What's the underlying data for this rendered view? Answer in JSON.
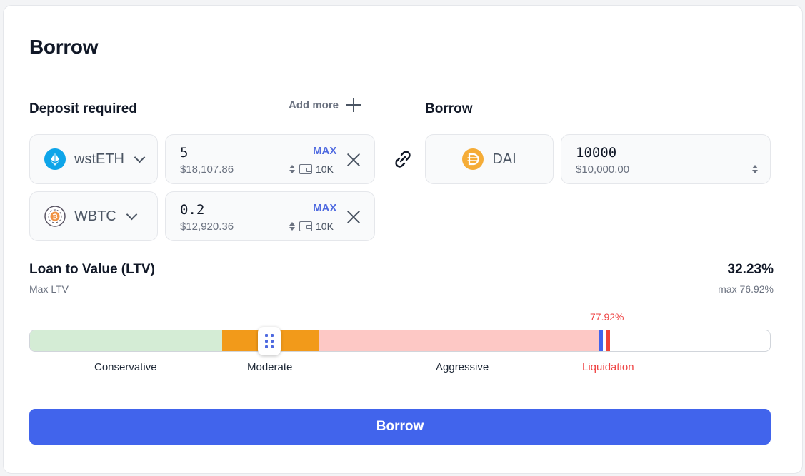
{
  "title": "Borrow",
  "deposit": {
    "label": "Deposit required",
    "add_more_label": "Add more",
    "rows": [
      {
        "token": "wstETH",
        "icon": "wsteth-token-icon",
        "amount": "5",
        "usd": "$18,107.86",
        "max_label": "MAX",
        "balance": "10K"
      },
      {
        "token": "WBTC",
        "icon": "wbtc-token-icon",
        "amount": "0.2",
        "usd": "$12,920.36",
        "max_label": "MAX",
        "balance": "10K"
      }
    ]
  },
  "borrow": {
    "label": "Borrow",
    "token": "DAI",
    "icon": "dai-token-icon",
    "amount": "10000",
    "usd": "$10,000.00"
  },
  "ltv": {
    "title": "Loan to Value (LTV)",
    "subtitle": "Max LTV",
    "value": "32.23%",
    "max": "max 76.92%",
    "liquidation_pct": "77.92%",
    "current_fraction": 0.3223,
    "zones": [
      {
        "label": "Conservative",
        "color": "#d4ecd5"
      },
      {
        "label": "Moderate",
        "color": "#f29a1a"
      },
      {
        "label": "Aggressive",
        "color": "#fdc8c5"
      },
      {
        "label": "Liquidation",
        "color": "#f04438"
      }
    ],
    "max_marker_color": "#4164ec"
  },
  "action": {
    "label": "Borrow",
    "color": "#4164ec"
  }
}
